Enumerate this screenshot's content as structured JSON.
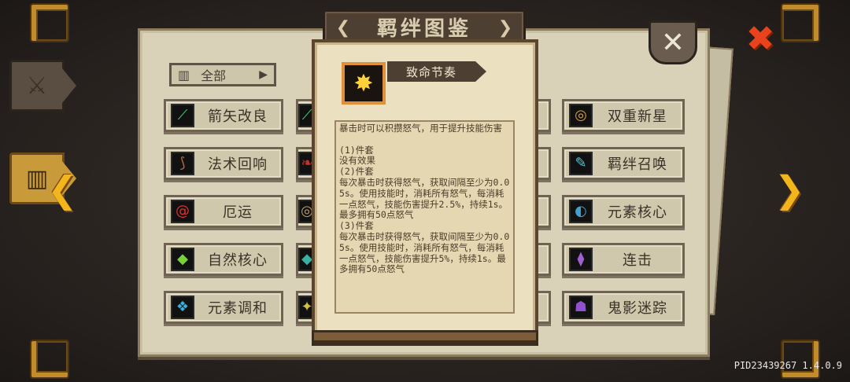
{
  "title": "羁绊图鉴",
  "filter": {
    "label": "全部",
    "icon": "book-icon"
  },
  "side_tabs": [
    {
      "name": "sword",
      "icon": "sword-icon"
    },
    {
      "name": "book",
      "icon": "book-icon"
    }
  ],
  "grid": {
    "col1": [
      {
        "label": "箭矢改良",
        "icon": "arrows-icon"
      },
      {
        "label": "法术回响",
        "icon": "staff-icon"
      },
      {
        "label": "厄运",
        "icon": "curse-icon"
      },
      {
        "label": "自然核心",
        "icon": "nature-core-icon"
      },
      {
        "label": "元素调和",
        "icon": "element-harmony-icon"
      }
    ],
    "col4": [
      {
        "label": "双重新星",
        "icon": "nova-icon"
      },
      {
        "label": "羁绊召唤",
        "icon": "summon-icon"
      },
      {
        "label": "元素核心",
        "icon": "element-core-icon"
      },
      {
        "label": "连击",
        "icon": "combo-icon"
      },
      {
        "label": "鬼影迷踪",
        "icon": "ghost-icon"
      }
    ]
  },
  "popup": {
    "name": "致命节奏",
    "icon": "critical-burst-icon",
    "description": "暴击时可以积攒怒气，用于提升技能伤害\n\n(1)件套\n没有效果\n(2)件套\n每次暴击时获得怒气，获取间隔至少为0.05s。使用技能时，消耗所有怒气，每消耗一点怒气，技能伤害提升2.5%，持续1s。最多拥有50点怒气\n(3)件套\n每次暴击时获得怒气，获取间隔至少为0.05s。使用技能时，消耗所有怒气，每消耗一点怒气，技能伤害提升5%，持续1s。最多拥有50点怒气"
  },
  "version": "PID23439267 1.4.0.9",
  "colors": {
    "accent": "#f2b61c",
    "close_red": "#e8431c",
    "parchment": "#d9d2b8"
  }
}
